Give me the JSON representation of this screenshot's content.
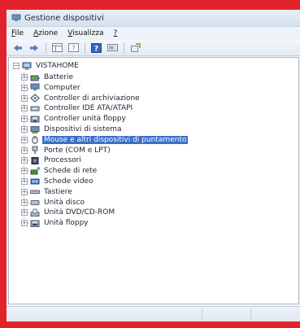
{
  "window": {
    "title": "Gestione dispositivi"
  },
  "menu": [
    {
      "label": "File",
      "accel": "F"
    },
    {
      "label": "Azione",
      "accel": "A"
    },
    {
      "label": "Visualizza",
      "accel": "V"
    },
    {
      "label": "?",
      "accel": "?"
    }
  ],
  "toolbar": [
    "back-icon",
    "forward-icon",
    "properties-grid-icon",
    "help-panel-icon",
    "help-icon",
    "scan-hardware-icon",
    "update-driver-icon"
  ],
  "tree": {
    "root": "VISTAHOME",
    "items": [
      {
        "label": "Batterie",
        "icon": "battery-icon"
      },
      {
        "label": "Computer",
        "icon": "computer-icon"
      },
      {
        "label": "Controller di archiviazione",
        "icon": "storage-controller-icon"
      },
      {
        "label": "Controller IDE ATA/ATAPI",
        "icon": "ide-controller-icon"
      },
      {
        "label": "Controller unità floppy",
        "icon": "floppy-controller-icon"
      },
      {
        "label": "Dispositivi di sistema",
        "icon": "system-devices-icon"
      },
      {
        "label": "Mouse e altri dispositivi di puntamento",
        "icon": "mouse-icon",
        "selected": true
      },
      {
        "label": "Porte (COM e LPT)",
        "icon": "port-icon"
      },
      {
        "label": "Processori",
        "icon": "processor-icon"
      },
      {
        "label": "Schede di rete",
        "icon": "network-card-icon"
      },
      {
        "label": "Schede video",
        "icon": "display-adapter-icon"
      },
      {
        "label": "Tastiere",
        "icon": "keyboard-icon"
      },
      {
        "label": "Unità disco",
        "icon": "disk-drive-icon"
      },
      {
        "label": "Unità DVD/CD-ROM",
        "icon": "dvd-drive-icon"
      },
      {
        "label": "Unità floppy",
        "icon": "floppy-drive-icon"
      }
    ]
  },
  "colors": {
    "selection": "#3a6fc8",
    "frame": "#e2232b"
  }
}
